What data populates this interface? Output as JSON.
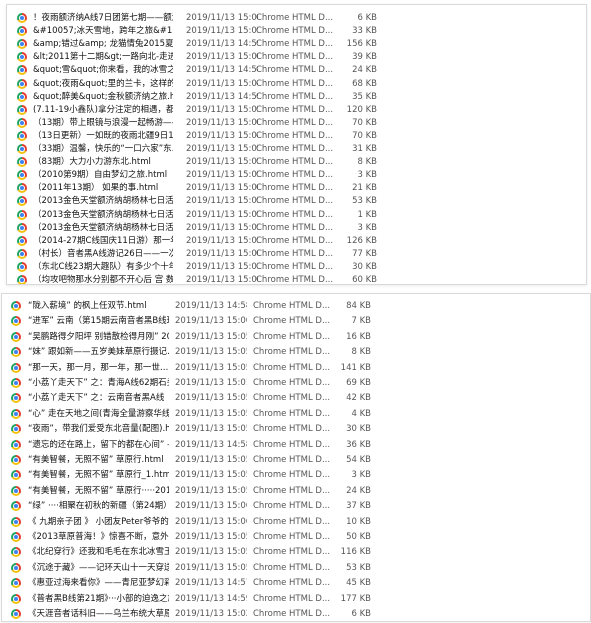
{
  "top_list": [
    {
      "name": "！夜雨额济纳A线7日团第七期——额济纳Ð…",
      "date": "2019/11/13 15:06",
      "type": "Chrome HTML D...",
      "size": "6 KB"
    },
    {
      "name": "&#10057;冰天雪地，跨年之旅&#10057;…",
      "date": "2019/11/13 15:05",
      "type": "Chrome HTML D...",
      "size": "33 KB"
    },
    {
      "name": "&amp;错过&amp; 龙猫情兔2015夏之…",
      "date": "2019/11/13 14:59",
      "type": "Chrome HTML D...",
      "size": "156 KB"
    },
    {
      "name": "&lt;2011第十二期&gt;一路向北-走进那…",
      "date": "2019/11/13 15:00",
      "type": "Chrome HTML D...",
      "size": "39 KB"
    },
    {
      "name": "&quot;雪&quot;你来看，我的冰雪之旅（东…",
      "date": "2019/11/13 14:58",
      "type": "Chrome HTML D...",
      "size": "24 KB"
    },
    {
      "name": "&quot;夜雨&quot;里的兰卡，这样的组…",
      "date": "2019/11/13 15:04",
      "type": "Chrome HTML D...",
      "size": "68 KB"
    },
    {
      "name": "&quot;醉美&quot;金秋额济纳之旅.html",
      "date": "2019/11/13 14:59",
      "type": "Chrome HTML D...",
      "size": "35 KB"
    },
    {
      "name": "(7.11-19小鑫队)拿分注定的相遇，都会…",
      "date": "2019/11/13 15:05",
      "type": "Chrome HTML D...",
      "size": "120 KB"
    },
    {
      "name": "（13期）带上眼镜与浪漫一起畅游——…",
      "date": "2019/11/13 15:06",
      "type": "Chrome HTML D...",
      "size": "70 KB"
    },
    {
      "name": "（13日更新）一如既的夜雨北疆9日12…",
      "date": "2019/11/13 15:04",
      "type": "Chrome HTML D...",
      "size": "70 KB"
    },
    {
      "name": "（33期）温馨，快乐的“一口六家”东…",
      "date": "2019/11/13 15:05",
      "type": "Chrome HTML D...",
      "size": "31 KB"
    },
    {
      "name": "（83期）大力小力游东北.html",
      "date": "2019/11/13 15:05",
      "type": "Chrome HTML D...",
      "size": "8 KB"
    },
    {
      "name": "（2010第9期）自由梦幻之旅.html",
      "date": "2019/11/13 15:05",
      "type": "Chrome HTML D...",
      "size": "3 KB"
    },
    {
      "name": "（2011年13期） 如果的事.html",
      "date": "2019/11/13 15:06",
      "type": "Chrome HTML D...",
      "size": "21 KB"
    },
    {
      "name": "（2013金色天堂额济纳胡杨林七日活动…",
      "date": "2019/11/13 15:05",
      "type": "Chrome HTML D...",
      "size": "53 KB"
    },
    {
      "name": "（2013金色天堂额济纳胡杨林七日活动…",
      "date": "2019/11/13 15:05",
      "type": "Chrome HTML D...",
      "size": "1 KB"
    },
    {
      "name": "（2013金色天堂额济纳胡杨林七日活动…",
      "date": "2019/11/13 15:05",
      "type": "Chrome HTML D...",
      "size": "3 KB"
    },
    {
      "name": "（2014-27期C线国庆11日游）那一年那…",
      "date": "2019/11/13 15:05",
      "type": "Chrome HTML D...",
      "size": "126 KB"
    },
    {
      "name": "（村长）音者黑A线游记26日——一次美丽…",
      "date": "2019/11/13 15:00",
      "type": "Chrome HTML D...",
      "size": "77 KB"
    },
    {
      "name": "（东北C线23期大趣队）有多少个十年可…",
      "date": "2019/11/13 15:03",
      "type": "Chrome HTML D...",
      "size": "30 KB"
    },
    {
      "name": "（均攻吧物那水分别都不开心后 宫 数是开…",
      "date": "2019/11/13 15:06",
      "type": "Chrome HTML D...",
      "size": "60 KB"
    }
  ],
  "bottom_list": [
    {
      "name": "“陇入薪境” 的枫上任双节.html",
      "date": "2019/11/13 14:58",
      "type": "Chrome HTML D...",
      "size": "84 KB"
    },
    {
      "name": "“进军” 云南（第15期云南音者黑B线球…",
      "date": "2019/11/13 15:00",
      "type": "Chrome HTML D...",
      "size": "7 KB"
    },
    {
      "name": "“吴鹏路得夕阳坪 别错散检得月刚” 201…",
      "date": "2019/11/13 15:05",
      "type": "Chrome HTML D...",
      "size": "16 KB"
    },
    {
      "name": "“妹” 跟如新——五岁美妹草原行摄记…",
      "date": "2019/11/13 15:05",
      "type": "Chrome HTML D...",
      "size": "8 KB"
    },
    {
      "name": "“那一天，那一月，那一年，那一世…",
      "date": "2019/11/13 15:05",
      "type": "Chrome HTML D...",
      "size": "141 KB"
    },
    {
      "name": "“小荔丫走天下” 之：青海A线62期石头…",
      "date": "2019/11/13 15:01",
      "type": "Chrome HTML D...",
      "size": "69 KB"
    },
    {
      "name": "“小荔丫走天下” 之：云南音者黑A线（…",
      "date": "2019/11/13 15:05",
      "type": "Chrome HTML D...",
      "size": "42 KB"
    },
    {
      "name": "“心” 走在天地之间(青海全量游察华线…",
      "date": "2019/11/13 15:05",
      "type": "Chrome HTML D...",
      "size": "4 KB"
    },
    {
      "name": "“夜雨”，带我们爱受东北音量(配图).htm",
      "date": "2019/11/13 15:05",
      "type": "Chrome HTML D...",
      "size": "30 KB"
    },
    {
      "name": "“遗忘的还在路上，留下的都在心间” —…",
      "date": "2019/11/13 14:58",
      "type": "Chrome HTML D...",
      "size": "36 KB"
    },
    {
      "name": "“有美智餐，无照不留” 草原行.html",
      "date": "2019/11/13 15:05",
      "type": "Chrome HTML D...",
      "size": "54 KB"
    },
    {
      "name": "“有美智餐，无照不留” 草原行_1.html",
      "date": "2019/11/13 15:05",
      "type": "Chrome HTML D...",
      "size": "3 KB"
    },
    {
      "name": "“有美智餐，无照不留” 草原行·····2014…",
      "date": "2019/11/13 15:05",
      "type": "Chrome HTML D...",
      "size": "24 KB"
    },
    {
      "name": "“绿” ····相聚在初秋的新疆（第24期）…",
      "date": "2019/11/13 15:06",
      "type": "Chrome HTML D...",
      "size": "37 KB"
    },
    {
      "name": "《 九期亲子团 》 小团友Peter爷爷的附…",
      "date": "2019/11/13 15:06",
      "type": "Chrome HTML D...",
      "size": "10 KB"
    },
    {
      "name": "《2013草原普海！》惊喜不断，意外连…",
      "date": "2019/11/13 15:05",
      "type": "Chrome HTML D...",
      "size": "50 KB"
    },
    {
      "name": "《北纪穿行》还我和毛毛在东北冰雪王国…",
      "date": "2019/11/13 15:05",
      "type": "Chrome HTML D...",
      "size": "116 KB"
    },
    {
      "name": "《沉途于藏》——记环天山十一天穿送…",
      "date": "2019/11/13 15:05",
      "type": "Chrome HTML D...",
      "size": "53 KB"
    },
    {
      "name": "《惠亚过海来看你》——青尼亚梦幻彩…",
      "date": "2019/11/13 14:57",
      "type": "Chrome HTML D...",
      "size": "45 KB"
    },
    {
      "name": "《普者黑B线第21期》···小部的迫逸之旅…",
      "date": "2019/11/13 14:59",
      "type": "Chrome HTML D...",
      "size": "177 KB"
    },
    {
      "name": "《天涯音者话科旧——乌兰布统大草原…",
      "date": "2019/11/13 15:02",
      "type": "Chrome HTML D...",
      "size": "6 KB"
    }
  ]
}
